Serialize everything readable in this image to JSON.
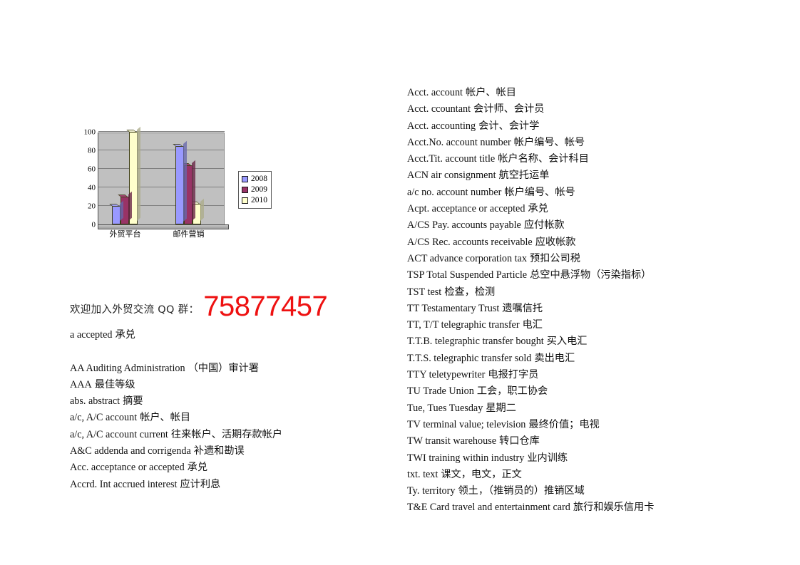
{
  "chart_data": {
    "type": "bar",
    "title": "",
    "xlabel": "",
    "ylabel": "",
    "categories": [
      "外贸平台",
      "邮件营销"
    ],
    "series": [
      {
        "name": "2008",
        "color": "#9999ff",
        "values": [
          20,
          85
        ]
      },
      {
        "name": "2009",
        "color": "#993366",
        "values": [
          30,
          64
        ]
      },
      {
        "name": "2010",
        "color": "#ffffcc",
        "values": [
          100,
          22
        ]
      }
    ],
    "ylim": [
      0,
      100
    ],
    "yticks": [
      0,
      20,
      40,
      60,
      80,
      100
    ],
    "ytick_labels": [
      "0",
      "20",
      "40",
      "60",
      "80",
      "100"
    ],
    "grid": true,
    "legend_position": "right",
    "plot_background": "#c0c0c0"
  },
  "qq_banner": {
    "text": "欢迎加入外贸交流 QQ 群：",
    "number": "75877457",
    "number_color": "#ee1111"
  },
  "left_column": [
    {
      "term": "a accepted",
      "gloss": "承兑"
    },
    {
      "term": "",
      "gloss": ""
    },
    {
      "term": "AA Auditing Administration",
      "gloss": "（中国）审计署"
    },
    {
      "term": "AAA",
      "gloss": "最佳等级"
    },
    {
      "term": "abs. abstract",
      "gloss": "摘要"
    },
    {
      "term": "a/c, A/C account",
      "gloss": "帐户、帐目"
    },
    {
      "term": "a/c, A/C account current",
      "gloss": "往来帐户、活期存款帐户"
    },
    {
      "term": "A&C addenda and corrigenda",
      "gloss": "补遗和勘误"
    },
    {
      "term": "Acc. acceptance or accepted",
      "gloss": "承兑"
    },
    {
      "term": "Accrd. Int accrued interest",
      "gloss": "应计利息"
    }
  ],
  "right_column": [
    {
      "term": "Acct. account",
      "gloss": "帐户、帐目"
    },
    {
      "term": "Acct. ccountant",
      "gloss": "会计师、会计员"
    },
    {
      "term": "Acct. accounting",
      "gloss": "会计、会计学"
    },
    {
      "term": "Acct.No. account number",
      "gloss": "帐户编号、帐号"
    },
    {
      "term": "Acct.Tit. account title",
      "gloss": "帐户名称、会计科目"
    },
    {
      "term": "ACN air consignment",
      "gloss": "航空托运单"
    },
    {
      "term": "a/c no. account number",
      "gloss": "帐户编号、帐号"
    },
    {
      "term": "Acpt. acceptance or accepted",
      "gloss": "承兑"
    },
    {
      "term": "A/CS Pay. accounts payable",
      "gloss": "应付帐款"
    },
    {
      "term": "A/CS Rec. accounts receivable",
      "gloss": "应收帐款"
    },
    {
      "term": "ACT advance corporation tax",
      "gloss": "预扣公司税"
    },
    {
      "term": "TSP Total Suspended Particle",
      "gloss": "总空中悬浮物（污染指标）"
    },
    {
      "term": "TST test",
      "gloss": "检查，检测"
    },
    {
      "term": "TT Testamentary Trust",
      "gloss": "遗嘱信托"
    },
    {
      "term": "TT, T/T telegraphic transfer",
      "gloss": "电汇"
    },
    {
      "term": "T.T.B. telegraphic transfer bought",
      "gloss": "买入电汇"
    },
    {
      "term": "T.T.S. telegraphic transfer sold",
      "gloss": "卖出电汇"
    },
    {
      "term": "TTY teletypewriter",
      "gloss": "电报打字员"
    },
    {
      "term": "TU Trade Union",
      "gloss": "工会，职工协会"
    },
    {
      "term": "Tue, Tues Tuesday",
      "gloss": "星期二"
    },
    {
      "term": "TV terminal value; television",
      "gloss": "最终价值；电视"
    },
    {
      "term": "TW transit warehouse",
      "gloss": "转口仓库"
    },
    {
      "term": "TWI training within industry",
      "gloss": "业内训练"
    },
    {
      "term": "txt. text",
      "gloss": "课文，电文，正文"
    },
    {
      "term": "Ty. territory",
      "gloss": "领土，（推销员的）推销区域"
    },
    {
      "term": "T&E Card travel and entertainment card",
      "gloss": "旅行和娱乐信用卡"
    }
  ]
}
